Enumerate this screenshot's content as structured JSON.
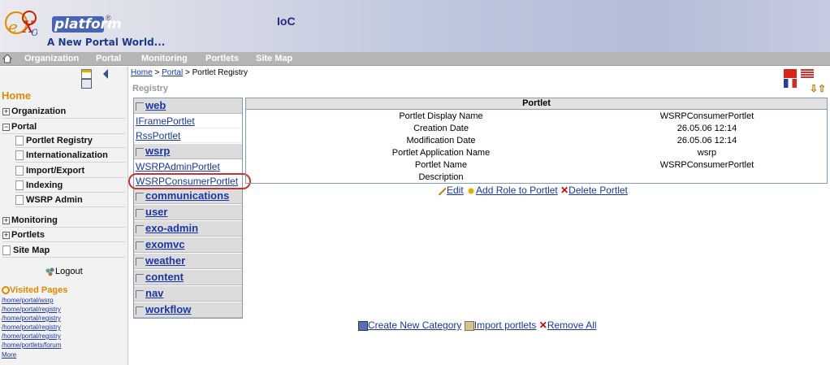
{
  "header": {
    "logo_main": "platform",
    "logo_exo": "eXo",
    "tagline": "A New Portal World...",
    "app_title": "IoC",
    "brand_color": "#4a64b4"
  },
  "menu": {
    "items": [
      "Organization",
      "Portal",
      "Monitoring",
      "Portlets",
      "Site Map"
    ]
  },
  "left": {
    "home_title": "Home",
    "nav": [
      {
        "label": "Organization",
        "toggle": "+"
      },
      {
        "label": "Portal",
        "toggle": "−"
      },
      {
        "label": "Portlet Registry"
      },
      {
        "label": "Internationalization"
      },
      {
        "label": "Import/Export"
      },
      {
        "label": "Indexing"
      },
      {
        "label": "WSRP Admin"
      },
      {
        "label": "Monitoring",
        "toggle": "+"
      },
      {
        "label": "Portlets",
        "toggle": "+"
      },
      {
        "label": "Site Map"
      }
    ],
    "logout": "Logout",
    "visited_title": "Visited Pages",
    "visited": [
      "/home/portal/wsrp",
      "/home/portal/registry",
      "/home/portal/registry",
      "/home/portal/registry",
      "/home/portal/registry",
      "/home/portlets/forum",
      "More"
    ]
  },
  "breadcrumb": {
    "home": "Home",
    "sep": " > ",
    "portal": "Portal",
    "current": "Portlet Registry"
  },
  "registry_title": "Registry",
  "categories": [
    {
      "label": "web"
    },
    {
      "portlet": "IFramePortlet"
    },
    {
      "portlet": "RssPortlet"
    },
    {
      "label": "wsrp"
    },
    {
      "portlet": "WSRPAdminPortlet"
    },
    {
      "portlet": "WSRPConsumerPortlet"
    },
    {
      "label": "communications"
    },
    {
      "label": "user"
    },
    {
      "label": "exo-admin"
    },
    {
      "label": "exomvc"
    },
    {
      "label": "weather"
    },
    {
      "label": "content"
    },
    {
      "label": "nav"
    },
    {
      "label": "workflow"
    }
  ],
  "detail": {
    "title": "Portlet",
    "rows": [
      {
        "key": "Portlet Display Name",
        "value": "WSRPConsumerPortlet"
      },
      {
        "key": "Creation Date",
        "value": "26.05.06 12:14"
      },
      {
        "key": "Modification Date",
        "value": "26.05.06 12:14"
      },
      {
        "key": "Portlet Application Name",
        "value": "wsrp"
      },
      {
        "key": "Portlet Name",
        "value": "WSRPConsumerPortlet"
      },
      {
        "key": "Description",
        "value": ""
      }
    ]
  },
  "actions": {
    "edit": "Edit",
    "add_role": "Add Role to Portlet",
    "delete": "Delete Portlet"
  },
  "bottom_actions": {
    "create": "Create New Category",
    "import": "Import portlets",
    "remove": "Remove All"
  },
  "colors": {
    "highlight": "#d0302a",
    "menubar": "#b5b5b5",
    "home_title": "#e08a00"
  }
}
